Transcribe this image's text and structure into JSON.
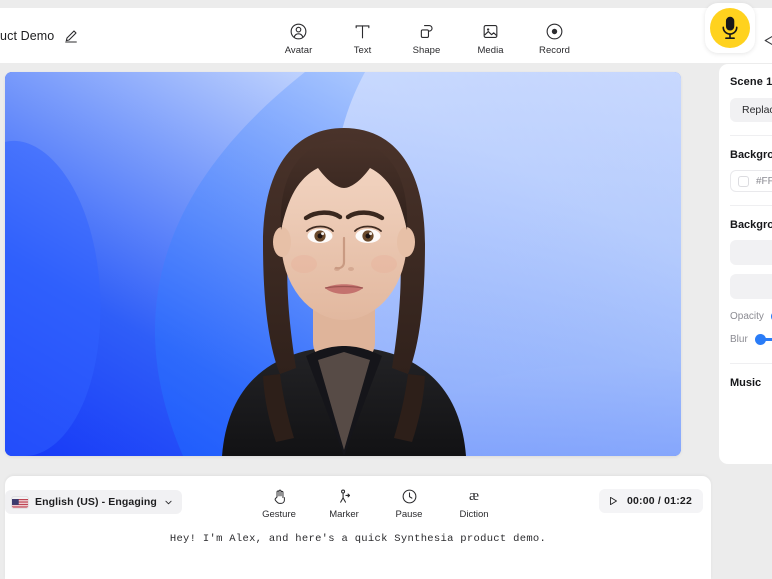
{
  "app": {
    "project_title": "duct Demo",
    "edit_icon": "pencil-icon",
    "undo_icon": "undo-arrow-icon",
    "mic_icon": "microphone-icon",
    "share_icon": "share-icon"
  },
  "toolbar": {
    "items": [
      {
        "label": "Avatar",
        "icon": "avatar-icon"
      },
      {
        "label": "Text",
        "icon": "text-icon"
      },
      {
        "label": "Shape",
        "icon": "shape-icon"
      },
      {
        "label": "Media",
        "icon": "media-icon"
      },
      {
        "label": "Record",
        "icon": "record-icon"
      }
    ]
  },
  "canvas": {
    "avatar_alt": "presenter-avatar",
    "background_gradient_start": "#1c4ef5",
    "background_gradient_end": "#e4ecff"
  },
  "sidebar": {
    "scene_title": "Scene 1",
    "replace_label": "Replace",
    "background_label": "Backgrou",
    "background_color_label": "Backgrou",
    "color_hex": "#FFF",
    "opacity_label": "Opacity",
    "blur_label": "Blur",
    "music_label": "Music",
    "accent_color": "#2a7cf7"
  },
  "bottom": {
    "language": "English (US) - Engaging",
    "language_flag": "us-flag-icon",
    "chevron_icon": "chevron-down-icon",
    "script_tools": [
      {
        "label": "Gesture",
        "icon": "hand-gesture-icon"
      },
      {
        "label": "Marker",
        "icon": "marker-pin-icon"
      },
      {
        "label": "Pause",
        "icon": "clock-pause-icon"
      },
      {
        "label": "Diction",
        "icon": "diction-ae-icon"
      }
    ],
    "play_icon": "play-icon",
    "timecode": "00:00 / 01:22",
    "script_text": "Hey! I'm Alex, and here's a quick Synthesia product demo."
  }
}
